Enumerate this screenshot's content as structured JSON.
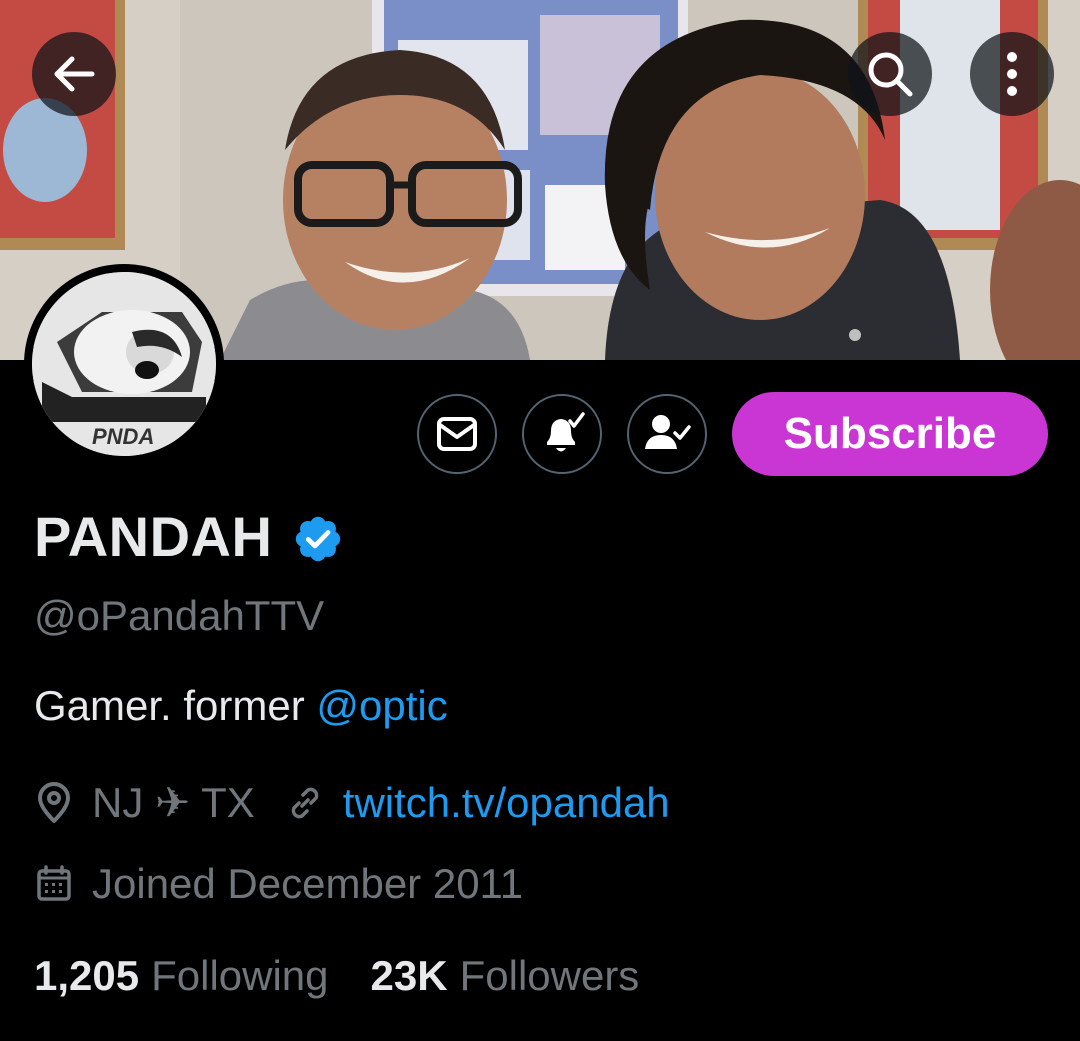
{
  "header": {
    "back_icon": "arrow-left-icon",
    "search_icon": "search-icon",
    "more_icon": "more-vertical-icon"
  },
  "avatar": {
    "logo_text": "PNDA"
  },
  "actions": {
    "message_icon": "envelope-icon",
    "notify_icon": "bell-check-icon",
    "following_icon": "person-check-icon",
    "subscribe_label": "Subscribe",
    "subscribe_color": "#c936d4"
  },
  "profile": {
    "display_name": "PANDAH",
    "verified": true,
    "verified_color": "#1d9bf0",
    "handle": "@oPandahTTV",
    "bio_text": "Gamer. former ",
    "bio_mention": "@optic",
    "location": "NJ ✈ TX",
    "website": "twitch.tv/opandah",
    "joined": "Joined December 2011"
  },
  "stats": {
    "following_count": "1,205",
    "following_label": "Following",
    "followers_count": "23K",
    "followers_label": "Followers"
  },
  "colors": {
    "background": "#000000",
    "text_primary": "#e7e9ea",
    "text_secondary": "#71767b",
    "link": "#1d9bf0",
    "border": "#536471"
  }
}
